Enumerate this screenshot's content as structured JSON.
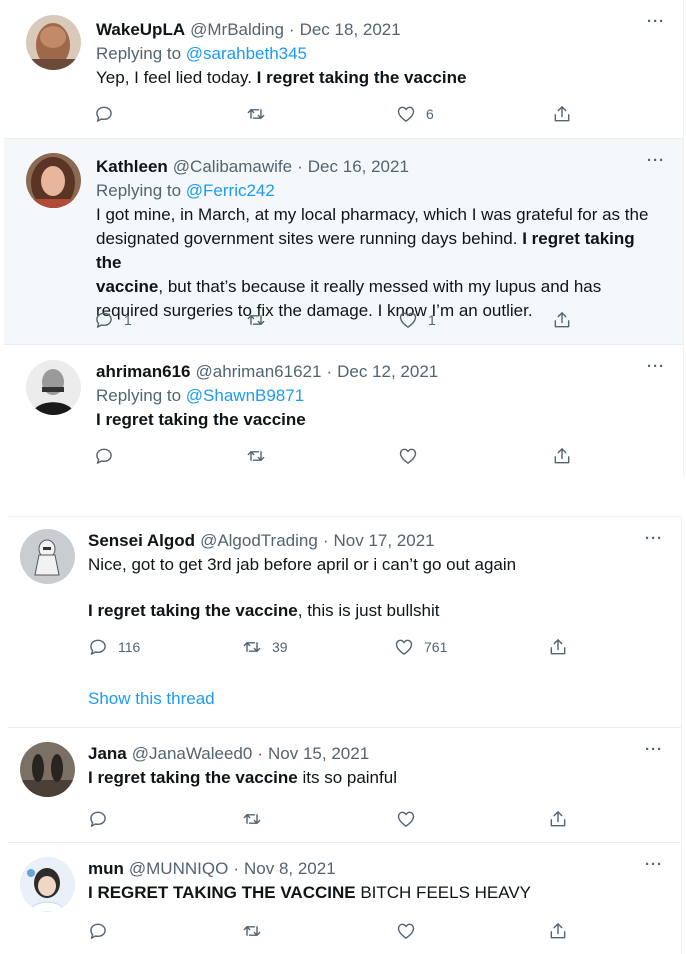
{
  "tweets": [
    {
      "name": "WakeUpLA",
      "handle": "@MrBalding",
      "date": "Dec 18, 2021",
      "replying_prefix": "Replying to ",
      "replying_to": "@sarahbeth345",
      "body": [
        {
          "t": "Yep, I feel lied today. ",
          "b": false
        },
        {
          "t": "I regret taking the vaccine",
          "b": true
        }
      ],
      "reply_count": "",
      "retweet_count": "",
      "like_count": "6"
    },
    {
      "name": "Kathleen",
      "handle": "@Calibamawife",
      "date": "Dec 16, 2021",
      "replying_prefix": "Replying to ",
      "replying_to": "@Ferric242",
      "body_lines": [
        [
          {
            "t": "I got mine, in March, at my local pharmacy, which I was grateful for as the",
            "b": false
          }
        ],
        [
          {
            "t": "designated government sites were running days behind. ",
            "b": false
          },
          {
            "t": "I regret taking the",
            "b": true
          }
        ],
        [
          {
            "t": "vaccine",
            "b": true
          },
          {
            "t": ", but that’s because it really messed with my lupus and has",
            "b": false
          }
        ],
        [
          {
            "t": "required surgeries to fix the damage. I know I’m an outlier.",
            "b": false
          }
        ]
      ],
      "reply_count": "1",
      "retweet_count": "",
      "like_count": "1"
    },
    {
      "name": "ahriman616",
      "handle": "@ahriman61621",
      "date": "Dec 12, 2021",
      "replying_prefix": "Replying to ",
      "replying_to": "@ShawnB9871",
      "body": [
        {
          "t": "I regret taking the vaccine",
          "b": true
        }
      ],
      "reply_count": "",
      "retweet_count": "",
      "like_count": ""
    },
    {
      "name": "Sensei Algod",
      "handle": "@AlgodTrading",
      "date": "Nov 17, 2021",
      "body_line1": "Nice, got to get 3rd jab before april or i can’t go out again",
      "body_line2": [
        {
          "t": "I regret taking the vaccine",
          "b": true
        },
        {
          "t": ", this is just bullshit",
          "b": false
        }
      ],
      "reply_count": "116",
      "retweet_count": "39",
      "like_count": "761",
      "show_thread": "Show this thread"
    },
    {
      "name": "Jana",
      "handle": "@JanaWaleed0",
      "date": "Nov 15, 2021",
      "body": [
        {
          "t": "I regret taking the vaccine",
          "b": true
        },
        {
          "t": " its so painful",
          "b": false
        }
      ],
      "reply_count": "",
      "retweet_count": "",
      "like_count": ""
    },
    {
      "name": "mun",
      "handle": "@MUNNIQO",
      "date": "Nov 8, 2021",
      "body": [
        {
          "t": "I REGRET TAKING THE VACCINE",
          "b": true
        },
        {
          "t": " BITCH FEELS HEAVY",
          "b": false
        }
      ],
      "reply_count": "",
      "retweet_count": "",
      "like_count": ""
    }
  ],
  "ui": {
    "more_glyph": "···",
    "dot": "·"
  },
  "icons": {
    "reply": "reply-icon",
    "retweet": "retweet-icon",
    "like": "heart-icon",
    "share": "share-icon"
  },
  "colors": {
    "link": "#1d9bf0",
    "secondary": "#536471",
    "highlight_bg": "#f5f8fa"
  }
}
